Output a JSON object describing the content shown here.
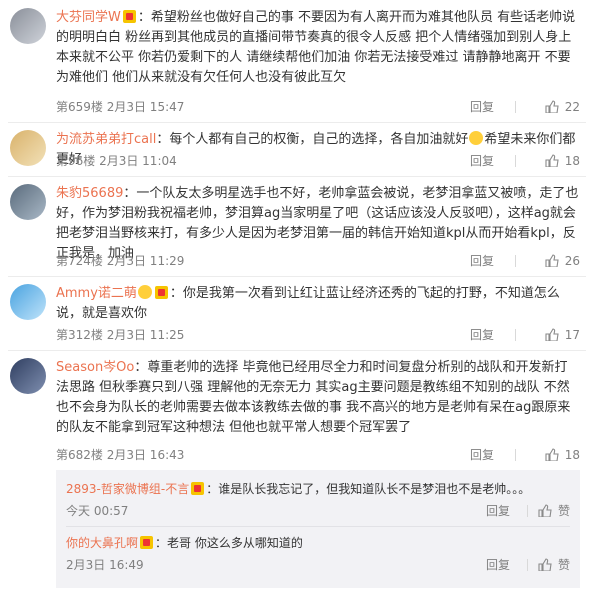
{
  "comments": [
    {
      "user": "大芬同学W",
      "text": "：希望粉丝也做好自己的事 不要因为有人离开而为难其他队员 有些话老帅说的明明白白 粉丝再到其他成员的直播间带节奏真的很令人反感 把个人情绪强加到别人身上本来就不公平 你若仍爱剩下的人 请继续帮他们加油 你若无法接受难过 请静静地离开 不要为难他们 他们从来就没有欠任何人也没有彼此互欠",
      "floor": "第659楼 2月3日 15:47",
      "reply": "回复",
      "likes": "22"
    },
    {
      "user": "为流苏弟弟打call",
      "text": "：每个人都有自己的权衡，自己的选择，各自加油就好",
      "text_tail": "希望未来你们都更好",
      "floor": "第96楼 2月3日 11:04",
      "reply": "回复",
      "likes": "18"
    },
    {
      "user": "朱豹56689",
      "text": "：一个队友太多明星选手也不好，老帅拿蓝会被说，老梦泪拿蓝又被喷，走了也好，作为梦泪粉我祝福老帅，梦泪算ag当家明星了吧（这话应该没人反驳吧），这样ag就会把老梦泪当野核来打，有多少人是因为老梦泪第一届的韩信开始知道kpl从而开始看kpl，反正我是，加油",
      "floor": "第724楼 2月3日 11:29",
      "reply": "回复",
      "likes": "26"
    },
    {
      "user": "Ammy诺二萌",
      "text": "：你是我第一次看到让红让蓝让经济还秀的飞起的打野，不知道怎么说，就是喜欢你",
      "floor": "第312楼 2月3日 11:25",
      "reply": "回复",
      "likes": "17"
    },
    {
      "user": "Season岑Oo",
      "text": "：尊重老帅的选择 毕竟他已经用尽全力和时间复盘分析别的战队和开发新打法思路 但秋季赛只到八强 理解他的无奈无力 其实ag主要问题是教练组不知别的战队 不然也不会身为队长的老帅需要去做本该教练去做的事 我不高兴的地方是老帅有呆在ag跟原来的队友不能拿到冠军这种想法 但他也就平常人想要个冠军罢了",
      "floor": "第682楼 2月3日 16:43",
      "reply": "回复",
      "likes": "18"
    }
  ],
  "sub_comments": [
    {
      "user": "2893-哲家微博组-不言",
      "text": "：谁是队长我忘记了，但我知道队长不是梦泪也不是老帅。。。",
      "time": "今天 00:57",
      "reply": "回复",
      "like_label": "赞"
    },
    {
      "user": "你的大鼻孔啊",
      "text": "：老哥 你这么多从哪知道的",
      "time": "2月3日 16:49",
      "reply": "回复",
      "like_label": "赞"
    }
  ]
}
